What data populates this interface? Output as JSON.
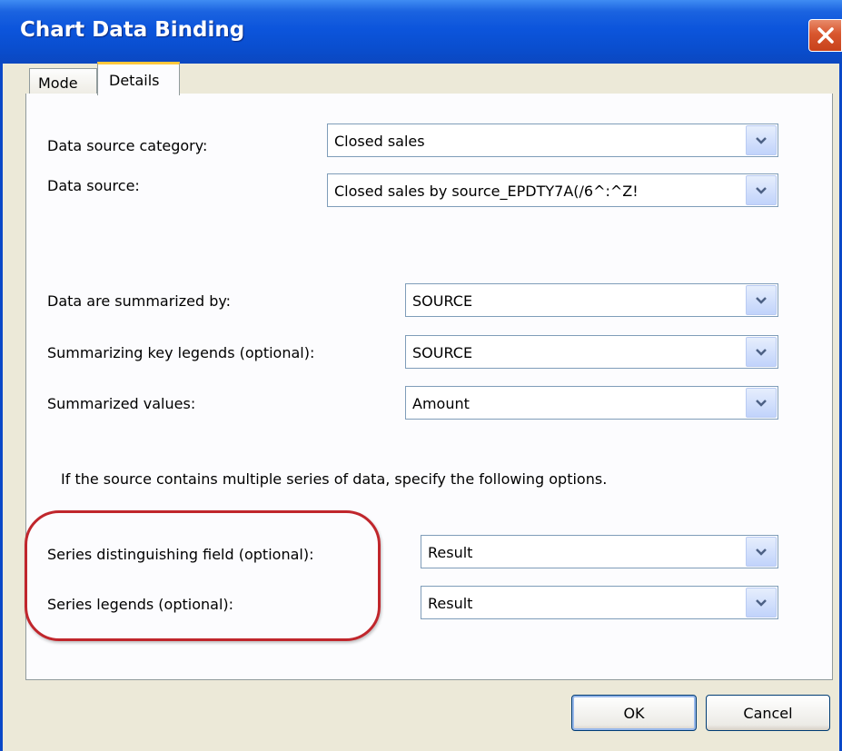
{
  "window": {
    "title": "Chart Data Binding"
  },
  "tabs": [
    {
      "label": "Mode",
      "selected": false
    },
    {
      "label": "Details",
      "selected": true
    }
  ],
  "fields": {
    "data_source_category": {
      "label": "Data source category:",
      "value": "Closed sales"
    },
    "data_source": {
      "label": "Data source:",
      "value": "Closed sales by source_EPDTY7A(/6^:^Z!"
    },
    "summarized_by": {
      "label": "Data are summarized by:",
      "value": "SOURCE"
    },
    "summarizing_key_legends": {
      "label": "Summarizing key legends (optional):",
      "value": "SOURCE"
    },
    "summarized_values": {
      "label": "Summarized values:",
      "value": "Amount"
    },
    "series_distinguishing_field": {
      "label": "Series distinguishing field (optional):",
      "value": "Result"
    },
    "series_legends": {
      "label": "Series legends (optional):",
      "value": "Result"
    }
  },
  "note": "If the source contains multiple series of data, specify the following options.",
  "buttons": {
    "ok": "OK",
    "cancel": "Cancel"
  },
  "icons": {
    "close": "close-icon",
    "dropdown": "chevron-down-icon"
  },
  "colors": {
    "titlebar": "#0a4ecf",
    "highlight": "#c0262c",
    "close": "#d8562e"
  }
}
